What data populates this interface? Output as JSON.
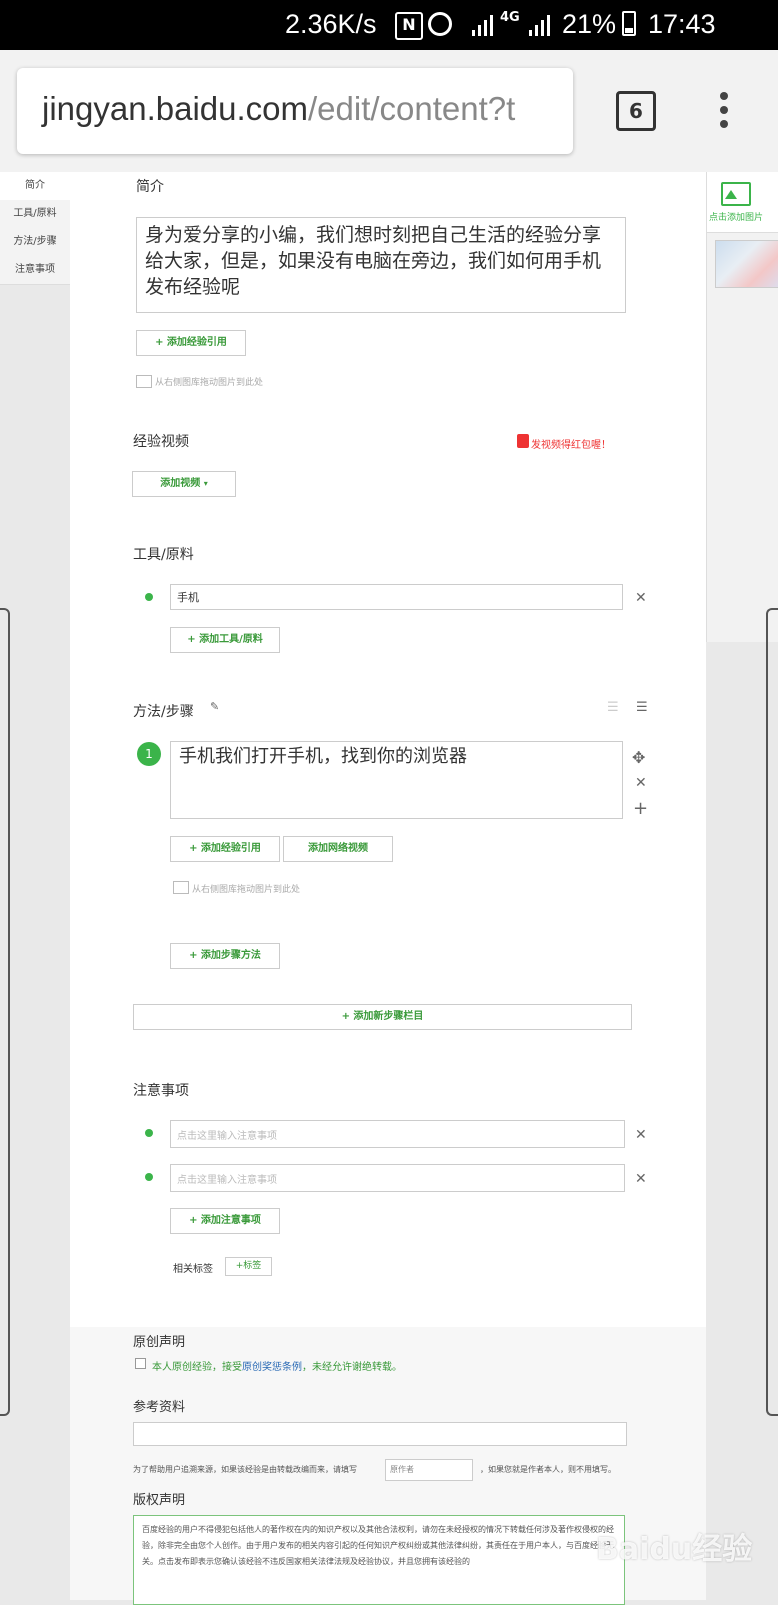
{
  "status": {
    "speed": "2.36K/s",
    "battery_pct": "21%",
    "time": "17:43",
    "network": "4G"
  },
  "browser": {
    "url_host": "jingyan.baidu.com",
    "url_path": "/edit/content?t",
    "tab_count": "6"
  },
  "nav": {
    "items": [
      "简介",
      "工具/原料",
      "方法/步骤",
      "注意事项"
    ]
  },
  "intro": {
    "title": "简介",
    "text": "身为爱分享的小编，我们想时刻把自己生活的经验分享给大家，但是，如果没有电脑在旁边，我们如何用手机发布经验呢",
    "add_ref_label": "+ 添加经验引用",
    "drag_hint": "从右侧图库拖动图片到此处"
  },
  "video": {
    "title": "经验视频",
    "add_label": "添加视频",
    "promo": "发视频得红包喔！"
  },
  "tools": {
    "title": "工具/原料",
    "items": [
      "手机"
    ],
    "add_label": "+ 添加工具/原料"
  },
  "steps": {
    "title": "方法/步骤",
    "items": [
      {
        "num": "1",
        "text": "手机我们打开手机，找到你的浏览器"
      }
    ],
    "add_ref_label": "+ 添加经验引用",
    "add_video_label": "添加网络视频",
    "drag_hint": "从右侧图库拖动图片到此处",
    "add_method_label": "+ 添加步骤方法",
    "add_section_label": "+ 添加新步骤栏目"
  },
  "notes": {
    "title": "注意事项",
    "placeholder": "点击这里输入注意事项",
    "add_label": "+ 添加注意事项",
    "tags_label": "相关标签",
    "add_tag_label": "+标签"
  },
  "original": {
    "title": "原创声明",
    "checkbox_text_1": "本人原创经验，接受",
    "checkbox_link": "原创奖惩条例",
    "checkbox_text_2": "，未经允许谢绝转载。"
  },
  "reference": {
    "title": "参考资料",
    "help_text_1": "为了帮助用户追溯来源，如果该经验是由转载改编而来，请填写",
    "author_placeholder": "原作者",
    "help_text_2": "，如果您就是作者本人，则不用填写。"
  },
  "copyright": {
    "title": "版权声明",
    "text": "百度经验的用户不得侵犯包括他人的著作权在内的知识产权以及其他合法权利，请勿在未经授权的情况下转载任何涉及著作权侵权的经验，除非完全由您个人创作。由于用户发布的相关内容引起的任何知识产权纠纷或其他法律纠纷，其责任在于用户本人，与百度经验无关。点击发布即表示您确认该经验不违反国家相关法律法规及经验协议，并且您拥有该经验的"
  },
  "right_panel": {
    "upload_label": "点击添加图片"
  },
  "watermark": "Baidu经验",
  "colors": {
    "accent_green": "#3bb44a",
    "link_blue": "#2a6ab5",
    "promo_red": "#e33"
  }
}
